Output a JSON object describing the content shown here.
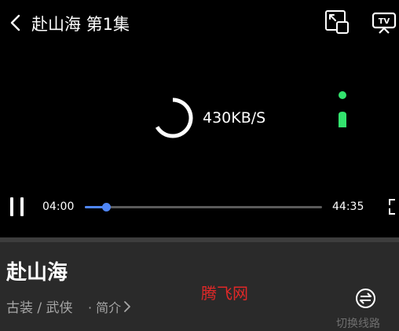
{
  "header": {
    "title": "赴山海 第1集",
    "back_icon": "chevron-left-icon",
    "pip_icon": "picture-in-picture-icon",
    "cast_icon": "tv-cast-icon"
  },
  "player": {
    "loading_icon": "loading-spinner-icon",
    "speed": "430KB/S",
    "lock_icon": "lock-icon",
    "lock_color": "#33e36e",
    "pause_icon": "pause-icon",
    "current_time": "04:00",
    "total_time": "44:35",
    "progress": 0.0897,
    "progress_color": "#4f86f7",
    "fullscreen_icon": "fullscreen-icon"
  },
  "info": {
    "title": "赴山海",
    "tags": "古装 / 武侠",
    "intro_label": "· 简介",
    "intro_chevron": "chevron-right-icon",
    "watermark": "腾飞网",
    "watermark_color": "#e02828",
    "switch_icon": "switch-source-icon",
    "switch_label": "切换线路"
  }
}
